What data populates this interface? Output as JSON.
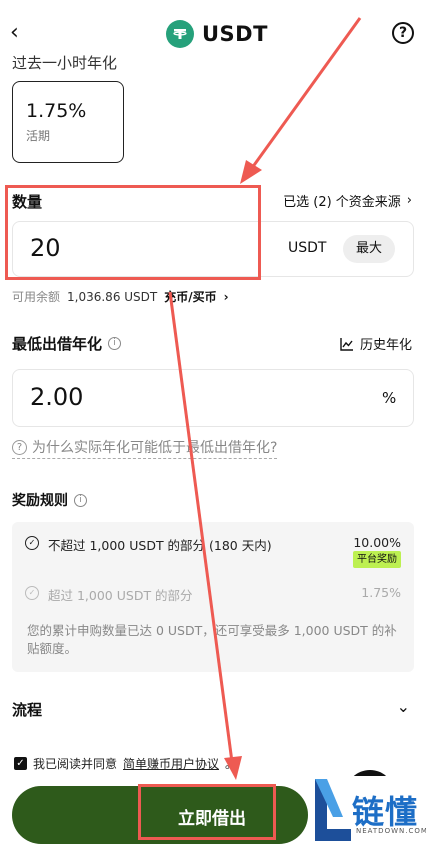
{
  "header": {
    "title": "USDT",
    "back_icon": "chevron-left-icon",
    "help_icon": "question-circle-icon",
    "coin_icon": "tether-logo-icon"
  },
  "rate_section": {
    "heading_cut": "过去一小时年化",
    "value": "1.75%",
    "type": "活期"
  },
  "quantity": {
    "label": "数量",
    "sources_link": "已选 (2) 个资金来源",
    "value": "20",
    "unit": "USDT",
    "max_button": "最大",
    "available_label": "可用余额",
    "available_amount": "1,036.86 USDT",
    "topup_link": "充币/买币"
  },
  "min_rate": {
    "label": "最低出借年化",
    "history_link": "历史年化",
    "value": "2.00",
    "unit": "%",
    "why_link": "为什么实际年化可能低于最低出借年化?"
  },
  "rewards": {
    "label": "奖励规则",
    "tiers": [
      {
        "text": "不超过 1,000 USDT 的部分 (180 天内)",
        "rate": "10.00%",
        "badge": "平台奖励"
      },
      {
        "text": "超过 1,000 USDT 的部分",
        "rate": "1.75%"
      }
    ],
    "subsidy_note": "您的累计申购数量已达 0 USDT，还可享受最多 1,000 USDT 的补贴额度。"
  },
  "process": {
    "label": "流程"
  },
  "agreement": {
    "prefix": "我已阅读并同意",
    "link": "简单赚币用户协议",
    "suffix": "。"
  },
  "cta": {
    "label": "立即借出"
  },
  "watermark": {
    "cn": "链懂",
    "en": "NEATDOWN.COM"
  },
  "colors": {
    "cta": "#2e5a1b",
    "badge": "#bdf051",
    "annotation": "#ee5a52",
    "tether": "#26a17b"
  }
}
